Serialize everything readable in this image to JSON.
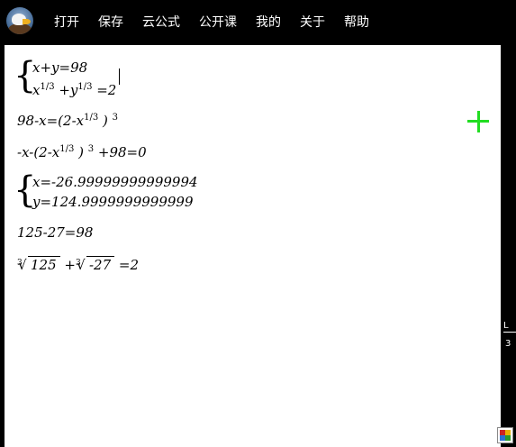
{
  "menu": [
    "打开",
    "保存",
    "云公式",
    "公开课",
    "我的",
    "关于",
    "帮助"
  ],
  "equations": {
    "system1": {
      "line1": "x+y=98",
      "line2_a": "x",
      "line2_b": "1/3",
      "line2_c": " +y",
      "line2_d": "1/3",
      "line2_e": " =2"
    },
    "line2": {
      "a": "98-x=(2-x",
      "b": "1/3",
      "c": " ) ",
      "d": "3"
    },
    "line3": {
      "a": "-x-(2-x",
      "b": "1/3",
      "c": " ) ",
      "d": "3",
      "e": " +98=0"
    },
    "system2": {
      "line1": "x=-26.99999999999994",
      "line2": "y=124.9999999999999"
    },
    "line5": "125-27=98",
    "line6": {
      "idx": "3",
      "rad1": "125",
      "plus": " +",
      "idx2": "3",
      "rad2": "-27",
      "eq": " =2"
    }
  },
  "side": {
    "mark": "L",
    "num": "3"
  },
  "colors": {
    "accent_cross": "#22dd22",
    "toolbar": "#000000",
    "canvas": "#ffffff"
  }
}
